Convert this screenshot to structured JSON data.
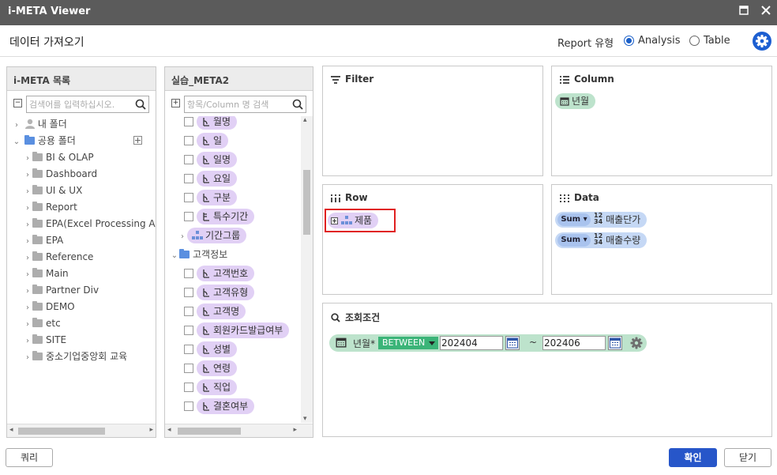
{
  "window": {
    "title": "i-META Viewer"
  },
  "header": {
    "dialog_title": "데이터 가져오기",
    "report_type_label": "Report 유형",
    "options": [
      {
        "label": "Analysis",
        "selected": true
      },
      {
        "label": "Table",
        "selected": false
      }
    ]
  },
  "left_panel": {
    "title": "i-META 목록",
    "search_placeholder": "검색어를 입력하십시오.",
    "my_folder": "내 폴더",
    "shared_folder": "공용 폴더",
    "folders": [
      "BI & OLAP",
      "Dashboard",
      "UI & UX",
      "Report",
      "EPA(Excel Processing Aut",
      "EPA",
      "Reference",
      "Main",
      "Partner Div",
      "DEMO",
      "etc",
      "SITE",
      "중소기업중앙회 교육"
    ]
  },
  "middle_panel": {
    "title": "실습_META2",
    "search_placeholder": "항목/Column 명 검색",
    "items_top": [
      "월명",
      "일",
      "일명",
      "요일",
      "구분",
      "특수기간"
    ],
    "group_item": "기간그룹",
    "folder": "고객정보",
    "items_customer": [
      "고객번호",
      "고객유형",
      "고객명",
      "회원카드발급여부",
      "성별",
      "연령",
      "직업",
      "결혼여부"
    ]
  },
  "zones": {
    "filter": {
      "title": "Filter"
    },
    "column": {
      "title": "Column",
      "items": [
        "년월"
      ]
    },
    "row": {
      "title": "Row",
      "items": [
        "제품"
      ]
    },
    "data": {
      "title": "Data",
      "agg": "Sum",
      "num_top": "12",
      "num_bottom": "34",
      "items": [
        "매출단가",
        "매출수량"
      ]
    },
    "condition": {
      "title": "조회조건",
      "field": "년월*",
      "operator": "BETWEEN",
      "from": "202404",
      "tilde": "~",
      "to": "202406"
    }
  },
  "footer": {
    "query_button": "쿼리",
    "confirm_button": "확인",
    "close_button": "닫기"
  },
  "colors": {
    "titlebar": "#5b5b5b",
    "accent": "#2756c9",
    "purple_pill": "#e1d0f5",
    "green_pill": "#bde3cc",
    "row_highlight": "#e02020"
  }
}
